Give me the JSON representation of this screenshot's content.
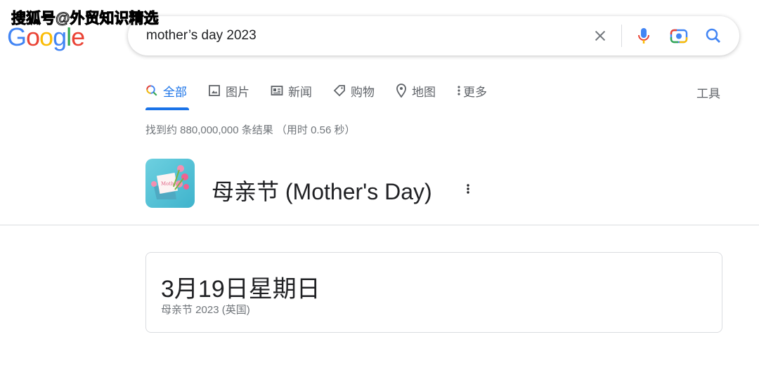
{
  "watermark": "搜狐号@外贸知识精选",
  "logo": {
    "letters": [
      "G",
      "o",
      "o",
      "g",
      "l",
      "e"
    ],
    "colors": [
      "#4285f4",
      "#ea4335",
      "#fbbc05",
      "#4285f4",
      "#34a853",
      "#ea4335"
    ]
  },
  "search": {
    "query": "mother’s day 2023",
    "icons": [
      "close-icon",
      "mic-icon",
      "camera-icon",
      "search-icon"
    ]
  },
  "tabs": [
    {
      "label": "全部",
      "icon": "search-icon",
      "active": true
    },
    {
      "label": "图片",
      "icon": "image-icon"
    },
    {
      "label": "新闻",
      "icon": "news-icon"
    },
    {
      "label": "购物",
      "icon": "tag-icon"
    },
    {
      "label": "地图",
      "icon": "pin-icon"
    },
    {
      "label": "更多",
      "icon": "more-vert-icon"
    }
  ],
  "tools": "工具",
  "stats": "找到约 880,000,000 条结果 （用时 0.56 秒）",
  "entity": {
    "title": "母亲节 (Mother's Day)",
    "thumb_text": "Mother"
  },
  "card": {
    "date": "3月19日星期日",
    "subtitle": "母亲节 2023 (英国)"
  },
  "colors": {
    "accent": "#1a73e8"
  }
}
